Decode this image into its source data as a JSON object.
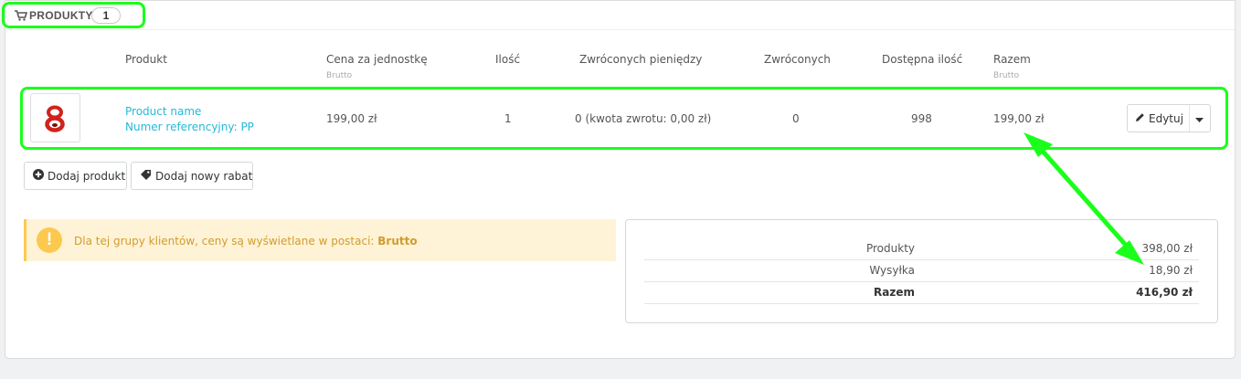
{
  "panel": {
    "title": "PRODUKTY",
    "count": "1"
  },
  "table": {
    "headers": {
      "product": "Produkt",
      "unit_price": "Cena za jednostkę",
      "unit_price_sub": "Brutto",
      "quantity": "Ilość",
      "refunded_money": "Zwróconych pieniędzy",
      "returned": "Zwróconych",
      "available_qty": "Dostępna ilość",
      "total": "Razem",
      "total_sub": "Brutto"
    },
    "row": {
      "name": "Product name",
      "reference": "Numer referencyjny: PP",
      "unit_price": "199,00 zł",
      "quantity": "1",
      "refunded": "0 (kwota zwrotu: 0,00 zł)",
      "returned": "0",
      "available": "998",
      "total": "199,00 zł",
      "edit_label": "Edytuj"
    }
  },
  "actions": {
    "add_product": "Dodaj produkt",
    "add_discount": "Dodaj nowy rabat"
  },
  "alert": {
    "text": "Dla tej grupy klientów, ceny są wyświetlane w postaci:",
    "emphasis": "Brutto"
  },
  "summary": {
    "products_label": "Produkty",
    "products_value": "398,00 zł",
    "shipping_label": "Wysyłka",
    "shipping_value": "18,90 zł",
    "total_label": "Razem",
    "total_value": "416,90 zł"
  },
  "colors": {
    "accent_link": "#25b9d7",
    "warning": "#fcc94f",
    "annotation": "#1aff1a"
  },
  "icons": [
    "cart-icon",
    "pencil-icon",
    "caret-down-icon",
    "plus-circle-icon",
    "tag-icon",
    "exclamation-icon"
  ]
}
